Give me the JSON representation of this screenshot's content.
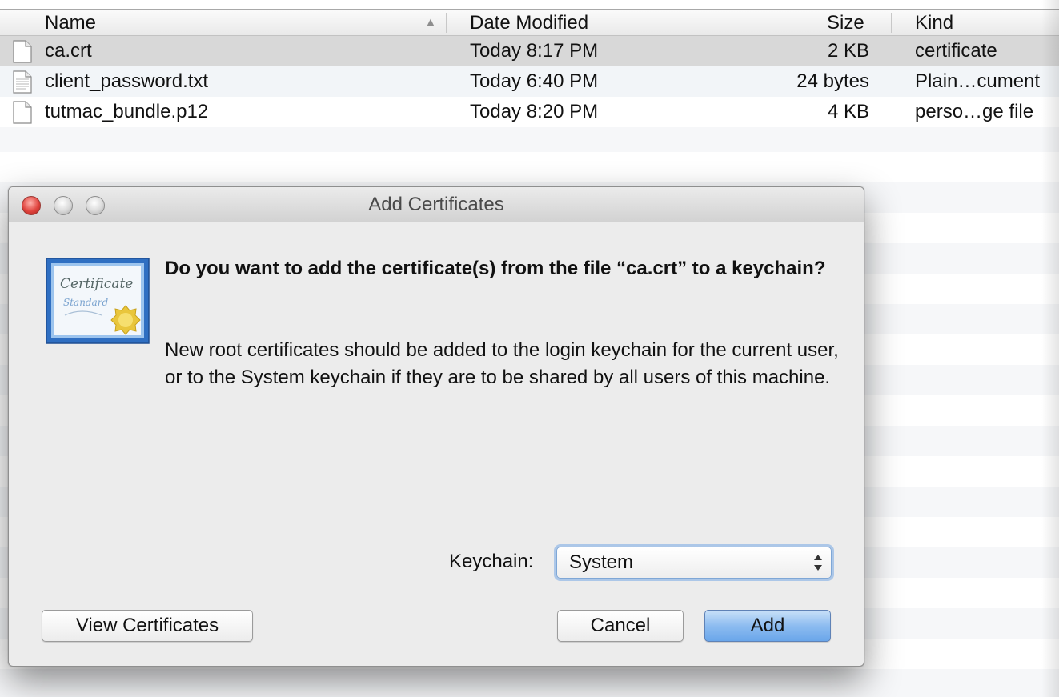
{
  "finder": {
    "columns": {
      "name": "Name",
      "date": "Date Modified",
      "size": "Size",
      "kind": "Kind"
    },
    "sort_indicator": "▲",
    "files": [
      {
        "name": "ca.crt",
        "date": "Today 8:17 PM",
        "size": "2 KB",
        "kind": "certificate",
        "selected": true
      },
      {
        "name": "client_password.txt",
        "date": "Today 6:40 PM",
        "size": "24 bytes",
        "kind": "Plain…cument",
        "selected": false
      },
      {
        "name": "tutmac_bundle.p12",
        "date": "Today 8:20 PM",
        "size": "4 KB",
        "kind": "perso…ge file",
        "selected": false
      }
    ]
  },
  "dialog": {
    "title": "Add Certificates",
    "icon": "certificate-icon",
    "icon_text": {
      "line1": "Certificate",
      "line2": "Standard"
    },
    "question": "Do you want to add the certificate(s) from the file “ca.crt” to a keychain?",
    "info": "New root certificates should be added to the login keychain for the current user, or to the System keychain if they are to be shared by all users of this machine.",
    "keychain_label": "Keychain:",
    "keychain_value": "System",
    "buttons": {
      "view": "View Certificates",
      "cancel": "Cancel",
      "add": "Add"
    }
  },
  "colors": {
    "close_light": "#e0443e",
    "default_button": "#6aa6ea",
    "selection_row": "#d8d8d8"
  }
}
